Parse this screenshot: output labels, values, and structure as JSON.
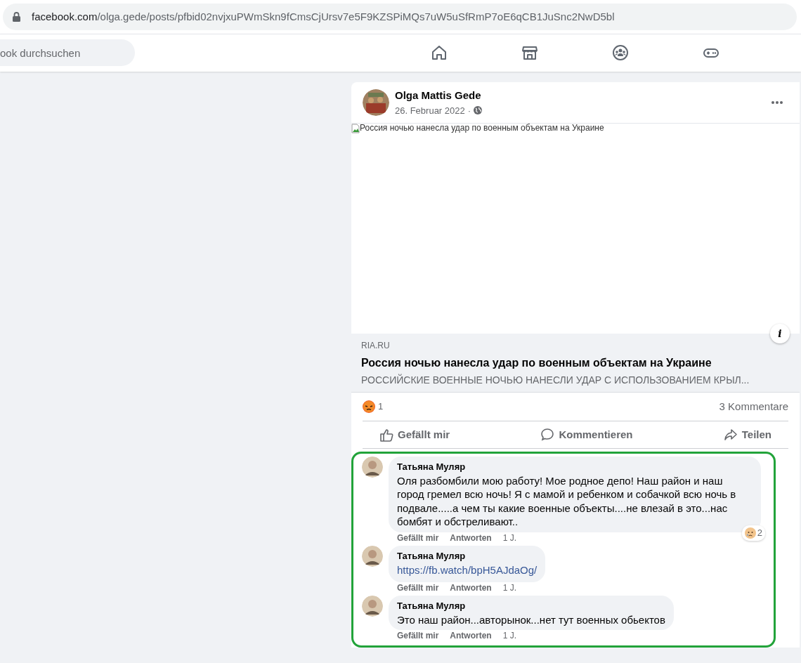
{
  "address_bar": {
    "domain": "facebook.com",
    "path": "/olga.gede/posts/pfbid02nvjxuPWmSkn9fCmsCjUrsv7e5F9KZSPiMQs7uW5uSfRmP7oE6qCB1JuSnc2NwD5bl"
  },
  "search": {
    "placeholder": "ook durchsuchen"
  },
  "post": {
    "author": "Olga Mattis Gede",
    "date": "26. Februar 2022",
    "separator": "·",
    "info_label": "i",
    "image_alt": "Россия ночью нанесла удар по военным объектам на Украине",
    "link": {
      "source": "RIA.RU",
      "title": "Россия ночью нанесла удар по военным объектам на Украине",
      "description": "РОССИЙСКИЕ ВОЕННЫЕ НОЧЬЮ НАНЕСЛИ УДАР С ИСПОЛЬЗОВАНИЕМ КРЫЛ..."
    },
    "reaction_count": "1",
    "comment_count": "3 Kommentare",
    "actions": [
      {
        "label": "Gefällt mir"
      },
      {
        "label": "Kommentieren"
      },
      {
        "label": "Teilen"
      }
    ]
  },
  "comments": [
    {
      "author": "Татьяна Муляр",
      "kind": "text",
      "text": "Оля разбомбили мою работу! Мое родное депо! Наш район и наш город гремел всю ночь! Я с мамой и ребенком и собачкой всю ночь в подвале.....а чем ты какие военные объекты....не влезай в это...нас бомбят и обстреливают..",
      "reaction_count": "2",
      "like": "Gefällt mir",
      "reply": "Antworten",
      "age": "1 J."
    },
    {
      "author": "Татьяна Муляр",
      "kind": "link",
      "text": "https://fb.watch/bpH5AJdaOg/",
      "like": "Gefällt mir",
      "reply": "Antworten",
      "age": "1 J."
    },
    {
      "author": "Татьяна Муляр",
      "kind": "text",
      "text": "Это наш район...авторынок...нет тут военных обьектов",
      "like": "Gefällt mir",
      "reply": "Antworten",
      "age": "1 J."
    }
  ]
}
